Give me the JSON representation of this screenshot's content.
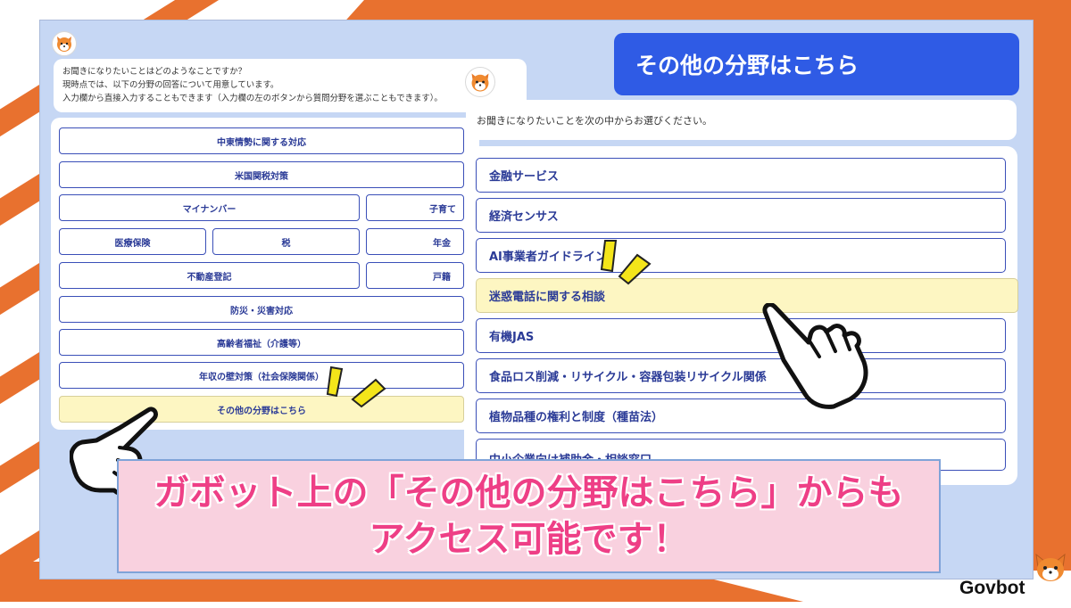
{
  "left_chat": {
    "intro_lines": [
      "お聞きになりたいことはどのようなことですか？",
      "現時点では、以下の分野の回答について用意しています。",
      "入力欄から直接入力することもできます（入力欄の左のボタンから質問分野を選ぶこともできます）。"
    ],
    "buttons": [
      "中東情勢に関する対応",
      "米国関税対策",
      "マイナンバー",
      "子育て",
      "医療保険",
      "税",
      "年金",
      "不動産登記",
      "戸籍",
      "防災・災害対応",
      "高齢者福祉（介護等）",
      "年収の壁対策（社会保険関係）",
      "その他の分野はこちら"
    ]
  },
  "right_chat": {
    "title": "その他の分野はこちら",
    "prompt": "お聞きになりたいことを次の中からお選びください。",
    "options": [
      "金融サービス",
      "経済センサス",
      "AI事業者ガイドライン",
      "迷惑電話に関する相談",
      "有機JAS",
      "食品ロス削減・リサイクル・容器包装リサイクル関係",
      "植物品種の権利と制度（種苗法）",
      "中小企業向け補助金・相談窓口"
    ]
  },
  "caption": {
    "line1": "ガボット上の「その他の分野はこちら」からも",
    "line2": "アクセス可能です！"
  },
  "brand": {
    "name": "Govbot"
  },
  "colors": {
    "accent_blue": "#2f5be5",
    "button_text": "#2b3b97",
    "highlight": "#fdf6c2",
    "orange": "#e8712f",
    "caption_pink": "#ee3f86"
  }
}
